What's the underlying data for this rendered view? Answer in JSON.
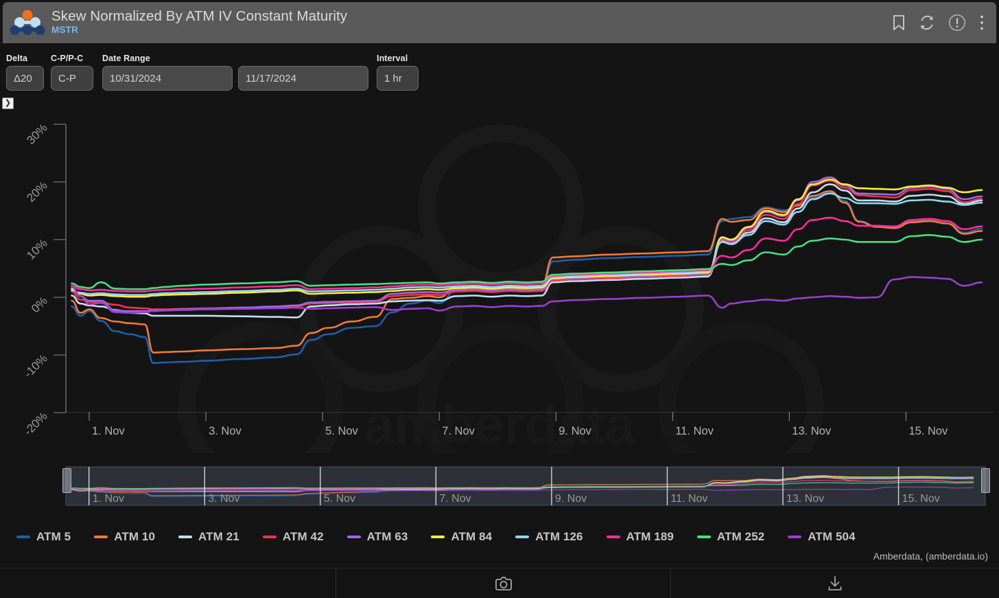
{
  "header": {
    "title": "Skew Normalized By ATM IV Constant Maturity",
    "subtitle": "MSTR",
    "logo_icon": "amberdata-molecule-logo",
    "icons": [
      {
        "name": "bookmark-icon",
        "label": "Bookmark"
      },
      {
        "name": "refresh-icon",
        "label": "Refresh"
      },
      {
        "name": "info-alert-icon",
        "label": "Info"
      },
      {
        "name": "kebab-menu-icon",
        "label": "More options"
      }
    ]
  },
  "controls": {
    "delta": {
      "label": "Delta",
      "value": "Δ20"
    },
    "cp_pc": {
      "label": "C-P/P-C",
      "value": "C-P"
    },
    "date_range": {
      "label": "Date Range",
      "start": "10/31/2024",
      "end": "11/17/2024"
    },
    "interval": {
      "label": "Interval",
      "value": "1 hr"
    },
    "expand_toggle": {
      "name": "expand-panel-chevron",
      "glyph": "❯"
    }
  },
  "credit": "Amberdata, (amberdata.io)",
  "watermark": "amberdata",
  "bottom_bar": {
    "screenshot_icon": "camera-icon",
    "download_icon": "download-icon"
  },
  "navigator": {
    "x_labels": [
      "1. Nov",
      "3. Nov",
      "5. Nov",
      "7. Nov",
      "9. Nov",
      "11. Nov",
      "13. Nov",
      "15. Nov"
    ],
    "handle_left_label": "range-handle-left",
    "handle_right_label": "range-handle-right"
  },
  "chart_data": {
    "type": "line",
    "title": "Skew Normalized By ATM IV Constant Maturity",
    "subtitle": "MSTR",
    "xlabel": "",
    "ylabel": "",
    "ylim": [
      -20,
      30
    ],
    "ytick_values": [
      30,
      20,
      10,
      0,
      -10,
      -20
    ],
    "ytick_labels": [
      "30%",
      "20%",
      "10%",
      "0%",
      "-10%",
      "-20%"
    ],
    "xtick_labels": [
      "1. Nov",
      "3. Nov",
      "5. Nov",
      "7. Nov",
      "9. Nov",
      "11. Nov",
      "13. Nov",
      "15. Nov"
    ],
    "xtick_days": [
      1,
      3,
      5,
      7,
      9,
      11,
      13,
      15
    ],
    "xlim_days": [
      0.6,
      16.5
    ],
    "grid": false,
    "legend_position": "bottom",
    "x_days": [
      0.7,
      0.85,
      1.0,
      1.2,
      1.45,
      1.7,
      1.95,
      2.1,
      2.3,
      2.6,
      3.0,
      3.6,
      4.2,
      4.55,
      4.8,
      5.1,
      5.5,
      5.9,
      6.2,
      6.5,
      6.8,
      7.0,
      7.3,
      7.6,
      7.9,
      8.2,
      8.5,
      8.75,
      8.95,
      9.3,
      9.9,
      10.5,
      11.1,
      11.6,
      11.85,
      12.0,
      12.3,
      12.6,
      12.9,
      13.15,
      13.4,
      13.7,
      13.95,
      14.2,
      14.5,
      14.8,
      15.1,
      15.4,
      15.7,
      16.0,
      16.3
    ],
    "series": [
      {
        "name": "ATM 5",
        "color": "#1e5fa8",
        "values": [
          -1.6,
          -3.2,
          -2.4,
          -4.1,
          -5.9,
          -6.4,
          -6.9,
          -11.4,
          -11.3,
          -11.2,
          -11.0,
          -10.7,
          -10.4,
          -9.9,
          -7.4,
          -6.4,
          -5.3,
          -5.0,
          -2.6,
          -1.1,
          -0.6,
          -1.0,
          1.3,
          1.2,
          0.9,
          1.1,
          1.0,
          1.2,
          6.2,
          6.5,
          6.8,
          7.0,
          7.2,
          7.4,
          13.2,
          13.6,
          13.9,
          15.6,
          15.1,
          16.0,
          17.3,
          18.1,
          16.7,
          13.2,
          12.3,
          12.1,
          13.3,
          13.5,
          13.2,
          11.2,
          11.9
        ]
      },
      {
        "name": "ATM 10",
        "color": "#f07a38",
        "values": [
          -0.6,
          -2.7,
          -2.1,
          -3.6,
          -4.2,
          -4.5,
          -4.7,
          -9.6,
          -9.5,
          -9.4,
          -9.2,
          -9.0,
          -8.8,
          -8.4,
          -6.2,
          -5.3,
          -4.2,
          -3.4,
          -0.3,
          -0.1,
          0.2,
          0.0,
          1.9,
          1.8,
          1.6,
          1.8,
          1.7,
          1.9,
          6.9,
          7.1,
          7.4,
          7.6,
          7.8,
          8.0,
          13.6,
          13.1,
          13.4,
          15.4,
          14.8,
          15.9,
          17.6,
          18.4,
          16.4,
          13.1,
          12.2,
          12.0,
          13.0,
          13.2,
          12.8,
          11.0,
          11.5
        ]
      },
      {
        "name": "ATM 21",
        "color": "#c2e0f2",
        "values": [
          0.3,
          -1.1,
          -1.4,
          -1.6,
          -2.2,
          -2.7,
          -2.8,
          -3.2,
          -3.2,
          -3.2,
          -3.2,
          -3.3,
          -3.4,
          -3.5,
          -1.6,
          -1.4,
          -1.2,
          -1.1,
          -0.7,
          -0.6,
          -0.5,
          -0.6,
          0.2,
          0.3,
          0.1,
          0.3,
          0.2,
          0.3,
          2.6,
          2.8,
          3.0,
          3.2,
          3.4,
          3.6,
          9.8,
          9.4,
          11.2,
          13.7,
          13.0,
          15.4,
          18.2,
          19.6,
          18.5,
          16.8,
          16.8,
          16.6,
          17.6,
          17.8,
          17.5,
          16.2,
          16.8
        ]
      },
      {
        "name": "ATM 42",
        "color": "#f0334f",
        "values": [
          1.0,
          -0.4,
          -0.8,
          -0.9,
          -1.3,
          -1.8,
          -1.9,
          -2.1,
          -2.1,
          -2.0,
          -1.9,
          -1.8,
          -1.7,
          -1.6,
          -1.1,
          -1.0,
          -0.9,
          -0.8,
          0.2,
          0.4,
          0.5,
          0.4,
          1.0,
          1.1,
          0.9,
          1.1,
          1.0,
          1.1,
          2.9,
          3.1,
          3.3,
          3.5,
          3.7,
          3.9,
          10.0,
          9.6,
          11.6,
          14.3,
          13.6,
          16.2,
          19.4,
          20.2,
          19.0,
          17.7,
          17.5,
          17.3,
          18.6,
          18.8,
          18.4,
          16.5,
          17.1
        ]
      },
      {
        "name": "ATM 63",
        "color": "#9c6ade",
        "values": [
          1.6,
          0.2,
          -0.6,
          -0.6,
          -2.3,
          -2.4,
          -2.4,
          -2.3,
          -2.2,
          -2.1,
          -2.0,
          -1.8,
          -1.6,
          -1.4,
          -0.9,
          -0.8,
          -0.7,
          -0.6,
          0.6,
          0.8,
          0.9,
          0.8,
          1.3,
          1.4,
          1.2,
          1.4,
          1.3,
          1.4,
          3.1,
          3.3,
          3.5,
          3.7,
          3.9,
          4.1,
          10.2,
          9.8,
          12.0,
          14.8,
          14.1,
          16.8,
          20.0,
          20.8,
          19.4,
          18.0,
          17.9,
          17.8,
          19.0,
          19.2,
          18.8,
          17.0,
          17.5
        ]
      },
      {
        "name": "ATM 84",
        "color": "#ffec3d",
        "values": [
          1.4,
          0.6,
          0.3,
          0.4,
          0.2,
          0.1,
          0.1,
          0.3,
          0.4,
          0.5,
          0.6,
          0.8,
          1.0,
          1.2,
          0.6,
          0.7,
          0.8,
          0.9,
          1.1,
          1.3,
          1.4,
          1.3,
          1.6,
          1.7,
          1.5,
          1.7,
          1.6,
          1.7,
          3.3,
          3.5,
          3.7,
          3.9,
          4.1,
          4.3,
          10.4,
          10.0,
          12.2,
          15.0,
          14.3,
          17.0,
          19.6,
          20.4,
          19.6,
          18.9,
          18.8,
          18.7,
          19.2,
          19.4,
          19.0,
          18.2,
          18.6
        ]
      },
      {
        "name": "ATM 126",
        "color": "#8ed7ee",
        "values": [
          1.2,
          0.8,
          0.6,
          0.7,
          0.5,
          0.4,
          0.4,
          0.6,
          0.7,
          0.8,
          0.9,
          1.1,
          1.3,
          1.5,
          1.0,
          1.1,
          1.2,
          1.3,
          1.5,
          1.7,
          1.8,
          1.7,
          1.9,
          2.0,
          1.8,
          2.0,
          1.9,
          2.0,
          3.5,
          3.7,
          3.9,
          4.1,
          4.3,
          4.5,
          9.6,
          9.2,
          10.8,
          13.2,
          12.6,
          14.8,
          17.0,
          18.0,
          17.2,
          16.3,
          16.3,
          16.2,
          16.8,
          16.9,
          16.6,
          16.0,
          16.4
        ]
      },
      {
        "name": "ATM 189",
        "color": "#ff2d9b",
        "values": [
          2.0,
          1.4,
          1.2,
          1.3,
          1.1,
          1.0,
          1.0,
          1.2,
          1.3,
          1.4,
          1.5,
          1.7,
          1.9,
          2.1,
          1.4,
          1.5,
          1.6,
          1.7,
          1.9,
          2.1,
          2.2,
          2.1,
          2.3,
          2.4,
          2.2,
          2.4,
          2.3,
          2.4,
          3.7,
          3.9,
          4.1,
          4.3,
          4.5,
          4.7,
          7.2,
          6.9,
          8.2,
          10.2,
          9.8,
          11.8,
          13.4,
          13.8,
          13.2,
          12.4,
          12.4,
          12.3,
          13.4,
          13.6,
          13.2,
          11.8,
          12.3
        ]
      },
      {
        "name": "ATM 252",
        "color": "#4ade80",
        "values": [
          2.4,
          1.8,
          1.6,
          2.6,
          1.5,
          1.4,
          1.4,
          1.6,
          1.8,
          2.0,
          2.2,
          2.4,
          2.6,
          2.8,
          2.0,
          2.1,
          2.2,
          2.3,
          2.4,
          2.5,
          2.6,
          2.4,
          2.6,
          2.7,
          2.5,
          2.7,
          2.6,
          2.7,
          3.9,
          4.1,
          4.3,
          4.5,
          4.7,
          4.9,
          5.8,
          5.6,
          6.4,
          7.8,
          7.4,
          8.8,
          9.8,
          10.2,
          10.0,
          9.6,
          9.6,
          9.6,
          10.6,
          10.8,
          10.5,
          9.6,
          10.0
        ]
      },
      {
        "name": "ATM 504",
        "color": "#9b3fd1",
        "values": [
          1.8,
          0.2,
          -1.2,
          -1.0,
          -2.6,
          -2.7,
          -2.6,
          -2.4,
          -2.3,
          -2.2,
          -2.1,
          -2.0,
          -1.9,
          -1.8,
          -2.0,
          -1.9,
          -1.8,
          -1.7,
          -2.2,
          -2.0,
          -1.9,
          -2.3,
          -1.6,
          -1.5,
          -1.7,
          -1.5,
          -1.6,
          -1.5,
          -0.7,
          -0.5,
          -0.3,
          -0.1,
          0.1,
          0.3,
          -1.8,
          -1.1,
          -0.7,
          -0.4,
          -0.6,
          -0.2,
          0.0,
          0.2,
          0.1,
          -0.1,
          0.0,
          3.1,
          3.5,
          3.4,
          3.2,
          2.0,
          2.6
        ]
      }
    ]
  }
}
